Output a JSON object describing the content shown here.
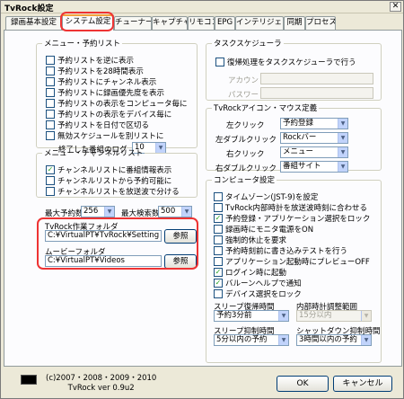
{
  "window": {
    "title": "TvRock設定",
    "close_glyph": "✕"
  },
  "tabs": [
    "録画基本設定",
    "システム設定",
    "チューナー",
    "キャプチャ",
    "リモコン",
    "EPG",
    "インテリジェント",
    "同期",
    "プロセス"
  ],
  "menu_reserve": {
    "title": "メニュー・予約リスト",
    "items": [
      {
        "label": "予約リストを逆に表示",
        "checked": false
      },
      {
        "label": "予約リストを28時間表示",
        "checked": false
      },
      {
        "label": "予約リストにチャンネル表示",
        "checked": false
      },
      {
        "label": "予約リストに録画優先度を表示",
        "checked": false
      },
      {
        "label": "予約リストの表示をコンピュータ毎に",
        "checked": false
      },
      {
        "label": "予約リストの表示をデバイス毎に",
        "checked": false
      },
      {
        "label": "予約リストを日付で区切る",
        "checked": false
      },
      {
        "label": "無効スケジュールを別リストに",
        "checked": false
      }
    ],
    "log_label": "終了した番組のログ",
    "log_value": "10"
  },
  "menu_channel": {
    "title": "メニュー・チャンネルリスト",
    "items": [
      {
        "label": "チャンネルリストに番組情報表示",
        "checked": true
      },
      {
        "label": "チャンネルリストから予約可能に",
        "checked": false
      },
      {
        "label": "チャンネルリストを放送波で分ける",
        "checked": false
      }
    ]
  },
  "max_reserve": {
    "label": "最大予約数",
    "value": "256"
  },
  "max_search": {
    "label": "最大検索数",
    "value": "500"
  },
  "work_folder": {
    "label": "TvRock作業フォルダ",
    "value": "C:¥VirtualPT¥TvRock¥Setting",
    "button": "参照"
  },
  "movie_folder": {
    "label": "ムービーフォルダ",
    "value": "C:¥VirtualPT¥Videos",
    "button": "参照"
  },
  "scheduler": {
    "title": "タスクスケジューラ",
    "checkbox": "復帰処理をタスクスケジューラで行う",
    "checked": false,
    "account_label": "アカウント",
    "password_label": "パスワード"
  },
  "icon_mouse": {
    "title": "TvRockアイコン・マウス定義",
    "rows": [
      {
        "label": "左クリック",
        "value": "予約登録"
      },
      {
        "label": "左ダブルクリック",
        "value": "Rockバー"
      },
      {
        "label": "右クリック",
        "value": "メニュー"
      },
      {
        "label": "右ダブルクリック",
        "value": "番組サイト"
      }
    ]
  },
  "computer": {
    "title": "コンピュータ設定",
    "items": [
      {
        "label": "タイムゾーン(JST-9)を設定",
        "checked": false
      },
      {
        "label": "TvRock内部時計を放送波時刻に合わせる",
        "checked": false
      },
      {
        "label": "予約登録・アプリケーション選択をロック",
        "checked": true
      },
      {
        "label": "録画時にモニタ電源をON",
        "checked": false
      },
      {
        "label": "強制的休止を要求",
        "checked": false
      },
      {
        "label": "予約時刻前に書き込みテストを行う",
        "checked": false
      },
      {
        "label": "アプリケーション起動時にプレビューOFF",
        "checked": false
      },
      {
        "label": "ログイン時に起動",
        "checked": true
      },
      {
        "label": "バルーンヘルプで通知",
        "checked": true
      },
      {
        "label": "デバイス選択をロック",
        "checked": false
      }
    ],
    "sleep_return": {
      "label": "スリープ復帰時間",
      "value": "予約3分前"
    },
    "clock_adjust": {
      "label": "内部時計調整範囲",
      "value": "15分以内"
    },
    "sleep_suppress": {
      "label": "スリープ抑制時間",
      "value": "5分以内の予約"
    },
    "shutdown_suppress": {
      "label": "シャットダウン抑制時間",
      "value": "3時間以内の予約"
    }
  },
  "footer": {
    "copyright": "(c)2007・2008・2009・2010",
    "version": "TvRock ver 0.9u2",
    "ok": "OK",
    "cancel": "キャンセル"
  }
}
